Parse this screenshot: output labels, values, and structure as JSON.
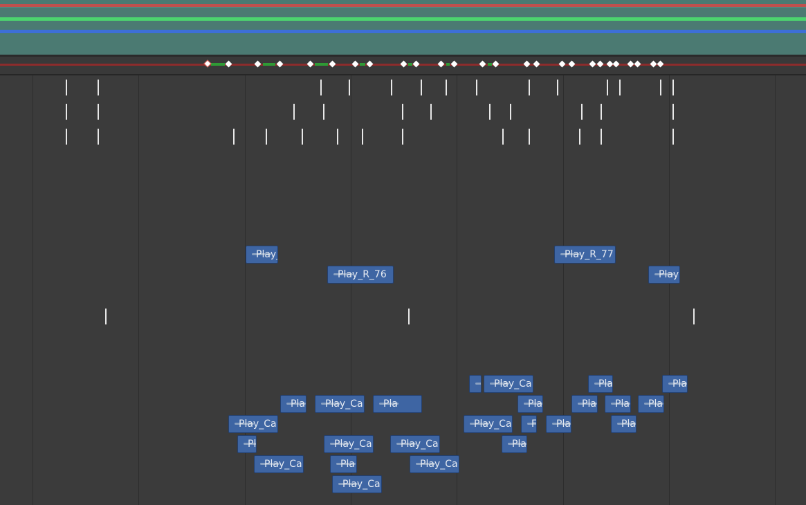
{
  "colors": {
    "header_bg": "#4b7a72",
    "band_red": "#c0504d",
    "band_green": "#4cd46e",
    "band_blue": "#3d6fd6",
    "keyline_red": "#8c2c2c",
    "keyline_green": "#2f9a35",
    "clip_bg": "#3e65a3",
    "canvas_bg": "#3b3b3b"
  },
  "clips": [
    {
      "label": "Play_",
      "kind": "music"
    },
    {
      "label": "Play_R_76",
      "kind": "music"
    },
    {
      "label": "Play_R_77",
      "kind": "music"
    },
    {
      "label": "Play",
      "kind": "music"
    },
    {
      "label": "",
      "kind": "sfx"
    },
    {
      "label": "Play_Ca",
      "kind": "sfx"
    },
    {
      "label": "Pla",
      "kind": "sfx"
    },
    {
      "label": "Pla",
      "kind": "sfx"
    },
    {
      "label": "Pla",
      "kind": "sfx"
    },
    {
      "label": "Play_Ca",
      "kind": "sfx"
    },
    {
      "label": "Play_Ca",
      "kind": "sfx"
    },
    {
      "label": "Pla",
      "kind": "sfx"
    },
    {
      "label": "Pla",
      "kind": "sfx"
    },
    {
      "label": "Pla",
      "kind": "sfx"
    },
    {
      "label": "Pla",
      "kind": "sfx"
    },
    {
      "label": "Play_Ca",
      "kind": "sfx"
    },
    {
      "label": "Play_Ca",
      "kind": "sfx"
    },
    {
      "label": "F",
      "kind": "sfx"
    },
    {
      "label": "Pla",
      "kind": "sfx"
    },
    {
      "label": "Pla",
      "kind": "sfx"
    },
    {
      "label": "Pl",
      "kind": "sfx"
    },
    {
      "label": "Play_Ca",
      "kind": "sfx"
    },
    {
      "label": "Play_Ca",
      "kind": "sfx"
    },
    {
      "label": "Pla",
      "kind": "sfx"
    },
    {
      "label": "Play_Ca",
      "kind": "sfx"
    },
    {
      "label": "Pla",
      "kind": "sfx"
    },
    {
      "label": "Play_Ca",
      "kind": "sfx"
    },
    {
      "label": "Play_Ca",
      "kind": "sfx"
    }
  ]
}
